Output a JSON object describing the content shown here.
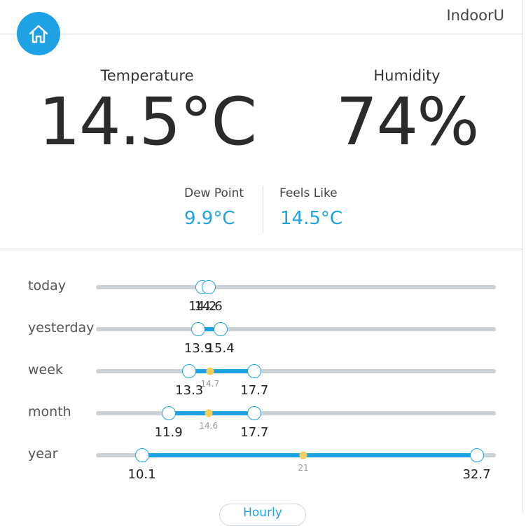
{
  "header": {
    "station_name": "IndoorU",
    "home_icon": "home-icon"
  },
  "current": {
    "temperature": {
      "label": "Temperature",
      "value": "14.5°C"
    },
    "humidity": {
      "label": "Humidity",
      "value": "74%"
    },
    "dew_point": {
      "label": "Dew Point",
      "value": "9.9°C"
    },
    "feels_like": {
      "label": "Feels Like",
      "value": "14.5°C"
    }
  },
  "scale": {
    "min": 7.0,
    "max": 34.0
  },
  "ranges": [
    {
      "label": "today",
      "min": 14.2,
      "max": 14.6,
      "min_text": "14.2",
      "max_text": "14.6",
      "avg": null,
      "avg_text": ""
    },
    {
      "label": "yesterday",
      "min": 13.9,
      "max": 15.4,
      "min_text": "13.9",
      "max_text": "15.4",
      "avg": null,
      "avg_text": ""
    },
    {
      "label": "week",
      "min": 13.3,
      "max": 17.7,
      "min_text": "13.3",
      "max_text": "17.7",
      "avg": 14.7,
      "avg_text": "14.7"
    },
    {
      "label": "month",
      "min": 11.9,
      "max": 17.7,
      "min_text": "11.9",
      "max_text": "17.7",
      "avg": 14.6,
      "avg_text": "14.6"
    },
    {
      "label": "year",
      "min": 10.1,
      "max": 32.7,
      "min_text": "10.1",
      "max_text": "32.7",
      "avg": 21,
      "avg_text": "21"
    }
  ],
  "colors": {
    "accent": "#1ea2e4",
    "track": "#ccd3d8",
    "avg_dot": "#f2d05a"
  },
  "bottom_button": {
    "label": "Hourly"
  }
}
